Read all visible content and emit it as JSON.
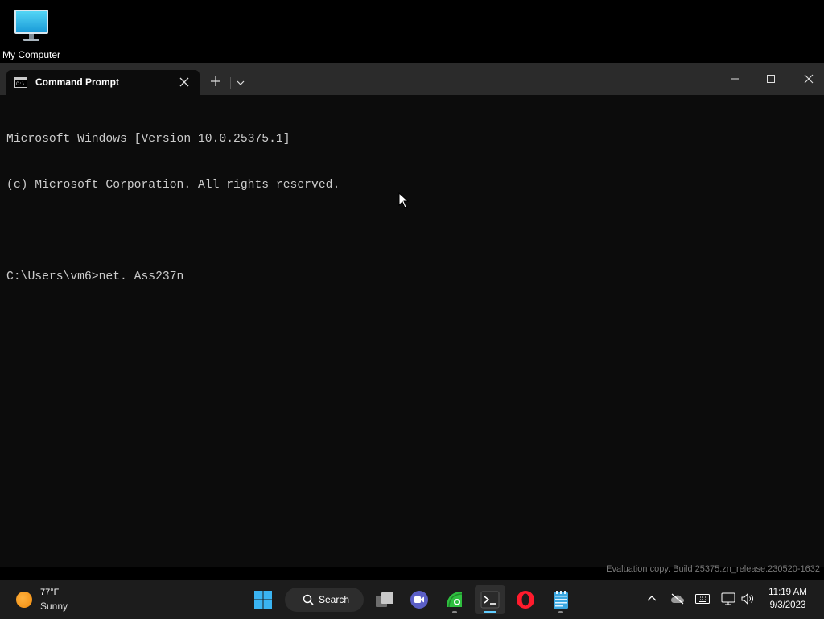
{
  "desktop": {
    "icons": [
      {
        "label": "My Computer",
        "icon": "computer-icon"
      }
    ]
  },
  "window": {
    "tab_title": "Command Prompt",
    "tab_icon": "cmd-icon",
    "buttons": {
      "minimize": "minimize-icon",
      "maximize": "maximize-icon",
      "close": "close-icon"
    }
  },
  "console": {
    "lines": [
      "Microsoft Windows [Version 10.0.25375.1]",
      "(c) Microsoft Corporation. All rights reserved.",
      "",
      "C:\\Users\\vm6>net. Ass237n"
    ]
  },
  "watermark": "Evaluation copy. Build 25375.zn_release.230520-1632",
  "taskbar": {
    "weather": {
      "temp": "77°F",
      "condition": "Sunny",
      "icon": "sun-icon"
    },
    "search_label": "Search",
    "apps": [
      {
        "name": "start-button",
        "icon": "windows-logo-icon"
      },
      {
        "name": "task-view-button",
        "icon": "task-view-icon"
      },
      {
        "name": "meet-app",
        "icon": "video-call-icon"
      },
      {
        "name": "green-app",
        "icon": "green-app-icon"
      },
      {
        "name": "terminal-app",
        "icon": "terminal-icon",
        "active": true
      },
      {
        "name": "opera-app",
        "icon": "opera-icon"
      },
      {
        "name": "notepad-app",
        "icon": "notepad-icon"
      }
    ],
    "clock": {
      "time": "11:19 AM",
      "date": "9/3/2023"
    }
  },
  "colors": {
    "console_bg": "#0c0c0c",
    "titlebar_bg": "#2b2b2b",
    "taskbar_bg": "#1c1c1c",
    "accent": "#60cdff"
  }
}
